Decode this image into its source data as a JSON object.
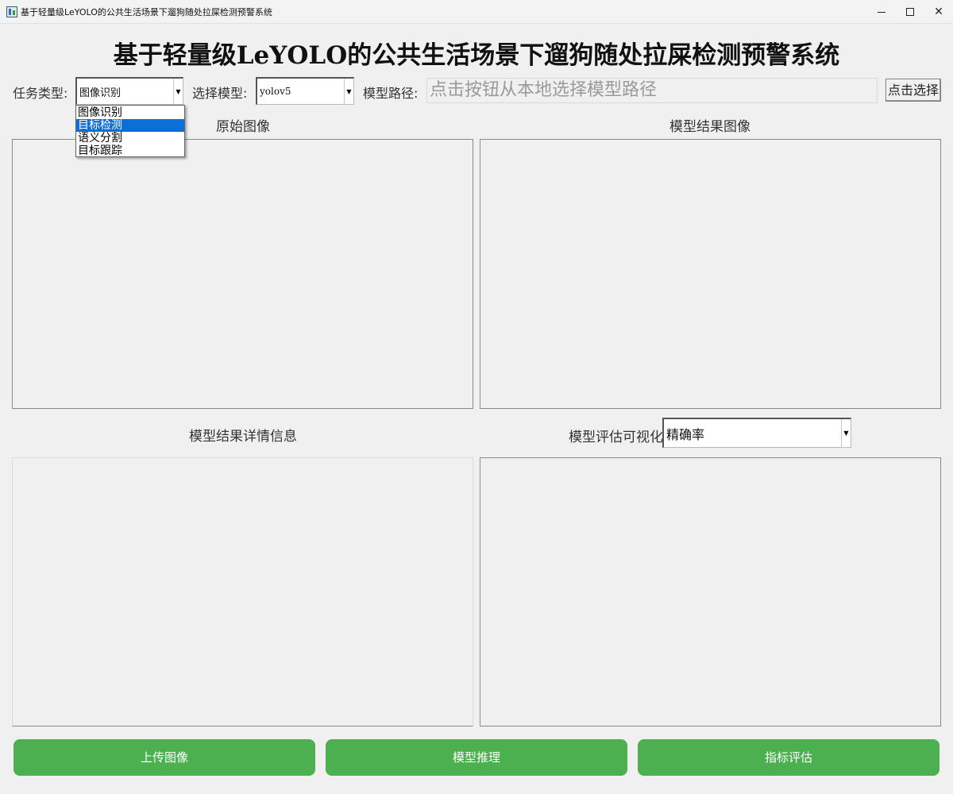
{
  "window": {
    "title": "基于轻量级LeYOLO的公共生活场景下遛狗随处拉屎检测预警系统",
    "minimize_glyph": "",
    "maximize_glyph": "",
    "close_glyph": "✕"
  },
  "app": {
    "title": "基于轻量级LeYOLO的公共生活场景下遛狗随处拉屎检测预警系统"
  },
  "toolbar": {
    "task_type_label": "任务类型:",
    "task_type_value": "图像识别",
    "task_type_options": [
      "图像识别",
      "目标检测",
      "语义分割",
      "目标跟踪"
    ],
    "task_type_highlighted_index": 1,
    "model_label": "选择模型:",
    "model_value": "yolov5",
    "model_path_label": "模型路径:",
    "model_path_placeholder": "点击按钮从本地选择模型路径",
    "select_button_label": "点击选择"
  },
  "panels": {
    "original_title": "原始图像",
    "result_title": "模型结果图像",
    "details_title": "模型结果详情信息",
    "eval_title": "模型评估可视化",
    "eval_metric_value": "精确率"
  },
  "actions": {
    "upload_label": "上传图像",
    "infer_label": "模型推理",
    "evaluate_label": "指标评估"
  },
  "colors": {
    "action_button": "#4caf50",
    "dropdown_highlight": "#0a6fd6"
  },
  "icons": {
    "app": "app-window-icon",
    "combo_arrow": "chevron-down-icon"
  }
}
